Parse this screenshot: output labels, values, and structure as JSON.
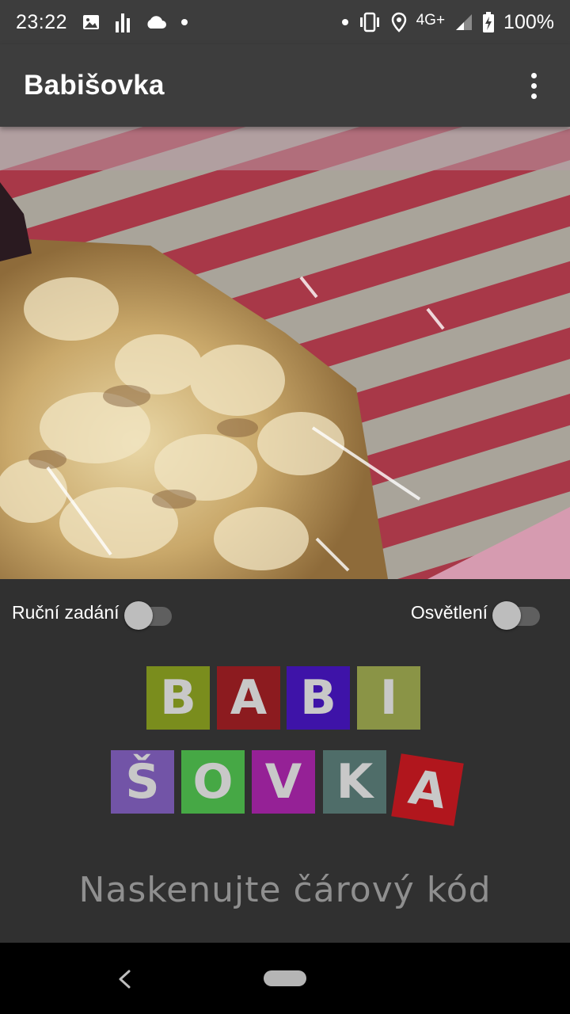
{
  "status_bar": {
    "time": "23:22",
    "network": "4G+",
    "battery": "100%",
    "left_icons": [
      "image-icon",
      "signal-bars-icon",
      "cloud-icon",
      "notification-dot-icon"
    ],
    "right_icons": [
      "notification-dot-icon",
      "vibrate-icon",
      "location-icon",
      "cell-signal-icon",
      "battery-charging-icon"
    ]
  },
  "app_bar": {
    "title": "Babišovka",
    "menu_icon": "more-vert-icon"
  },
  "camera": {
    "description_icon": "camera-preview"
  },
  "toggles": {
    "manual": {
      "label": "Ruční zadání",
      "on": false
    },
    "light": {
      "label": "Osvětlení",
      "on": false
    }
  },
  "logo": {
    "row1": [
      {
        "letter": "B",
        "color": "#7a8d1d"
      },
      {
        "letter": "A",
        "color": "#8c1b1f"
      },
      {
        "letter": "B",
        "color": "#3e13a8"
      },
      {
        "letter": "I",
        "color": "#8a9446"
      }
    ],
    "row2": [
      {
        "letter": "Š",
        "color": "#7254a7"
      },
      {
        "letter": "O",
        "color": "#46a845"
      },
      {
        "letter": "V",
        "color": "#952196"
      },
      {
        "letter": "K",
        "color": "#4f6d69"
      },
      {
        "letter": "A",
        "color": "#b1161d"
      }
    ]
  },
  "prompt": "Naskenujte čárový kód",
  "nav": {
    "back_icon": "back-chevron-icon",
    "home_icon": "home-pill-icon"
  }
}
